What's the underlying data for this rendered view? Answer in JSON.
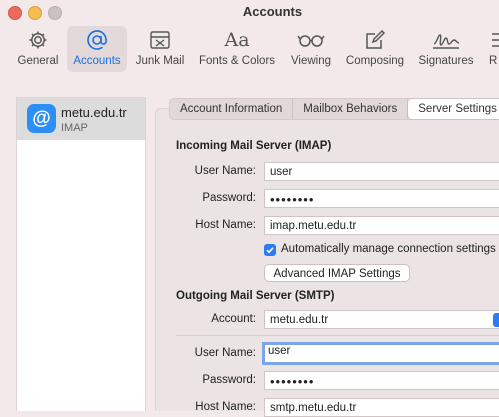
{
  "window": {
    "title": "Accounts"
  },
  "toolbar": {
    "items": [
      {
        "label": "General",
        "icon": "gear-icon"
      },
      {
        "label": "Accounts",
        "icon": "at-icon",
        "active": true
      },
      {
        "label": "Junk Mail",
        "icon": "junk-tray-icon"
      },
      {
        "label": "Fonts & Colors",
        "icon": "font-aa-icon",
        "glyph": "Aa"
      },
      {
        "label": "Viewing",
        "icon": "glasses-icon"
      },
      {
        "label": "Composing",
        "icon": "compose-pencil-icon"
      },
      {
        "label": "Signatures",
        "icon": "signature-icon"
      },
      {
        "label": "R",
        "icon": "rules-icon"
      }
    ]
  },
  "sidebar": {
    "accounts": [
      {
        "name": "metu.edu.tr",
        "type": "IMAP",
        "icon_glyph": "@"
      }
    ]
  },
  "tabs": [
    {
      "label": "Account Information"
    },
    {
      "label": "Mailbox Behaviors"
    },
    {
      "label": "Server Settings",
      "selected": true
    }
  ],
  "incoming": {
    "title": "Incoming Mail Server (IMAP)",
    "username_label": "User Name:",
    "username": "user",
    "password_label": "Password:",
    "password": "••••••••",
    "hostname_label": "Host Name:",
    "hostname": "imap.metu.edu.tr",
    "auto_manage_label": "Automatically manage connection settings",
    "auto_manage_checked": true,
    "advanced_button": "Advanced IMAP Settings"
  },
  "outgoing": {
    "title": "Outgoing Mail Server (SMTP)",
    "account_label": "Account:",
    "account": "metu.edu.tr",
    "username_label": "User Name:",
    "username": "user",
    "password_label": "Password:",
    "password": "••••••••",
    "hostname_label": "Host Name:",
    "hostname": "smtp.metu.edu.tr"
  },
  "colors": {
    "accent": "#2b7cf0",
    "window_bg": "#f3e9ea"
  }
}
